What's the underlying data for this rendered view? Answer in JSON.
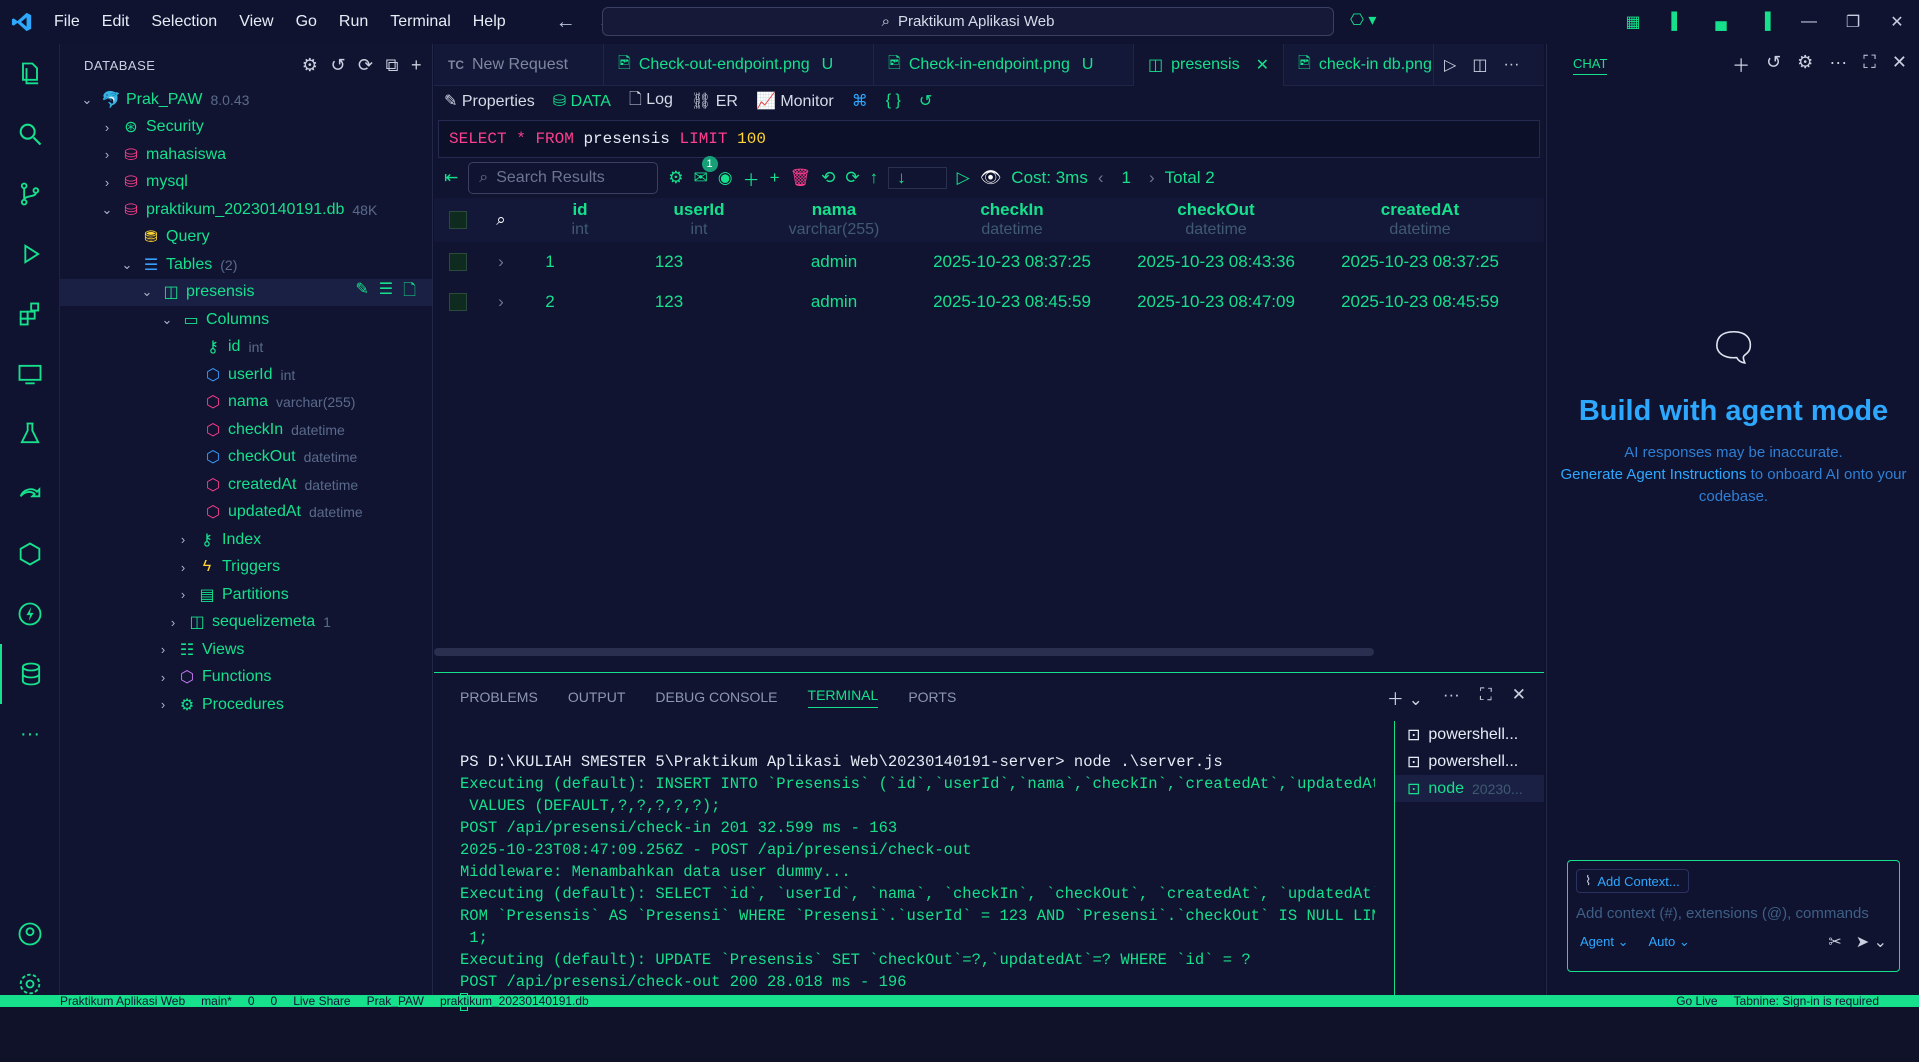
{
  "menu": [
    "File",
    "Edit",
    "Selection",
    "View",
    "Go",
    "Run",
    "Terminal",
    "Help"
  ],
  "command_center": "Praktikum Aplikasi Web",
  "sidebar": {
    "title": "DATABASE",
    "connection": {
      "name": "Prak_PAW",
      "version": "8.0.43"
    },
    "items": [
      {
        "label": "Security"
      },
      {
        "label": "mahasiswa"
      },
      {
        "label": "mysql"
      },
      {
        "label": "praktikum_20230140191.db",
        "sub": "48K"
      },
      {
        "label": "Query"
      },
      {
        "label": "Tables",
        "sub": "(2)"
      },
      {
        "label": "presensis"
      },
      {
        "label": "Columns"
      },
      {
        "label": "id",
        "sub": "int"
      },
      {
        "label": "userId",
        "sub": "int"
      },
      {
        "label": "nama",
        "sub": "varchar(255)"
      },
      {
        "label": "checkIn",
        "sub": "datetime"
      },
      {
        "label": "checkOut",
        "sub": "datetime"
      },
      {
        "label": "createdAt",
        "sub": "datetime"
      },
      {
        "label": "updatedAt",
        "sub": "datetime"
      },
      {
        "label": "Index"
      },
      {
        "label": "Triggers"
      },
      {
        "label": "Partitions"
      },
      {
        "label": "sequelizemeta",
        "sub": "1"
      },
      {
        "label": "Views"
      },
      {
        "label": "Functions"
      },
      {
        "label": "Procedures"
      }
    ]
  },
  "tabs": [
    {
      "label": "New Request",
      "prefix": "TC"
    },
    {
      "label": "Check-out-endpoint.png",
      "badge": "U"
    },
    {
      "label": "Check-in-endpoint.png",
      "badge": "U"
    },
    {
      "label": "presensis"
    },
    {
      "label": "check-in db.png"
    }
  ],
  "subtool": [
    "Properties",
    "DATA",
    "Log",
    "ER",
    "Monitor"
  ],
  "sql": {
    "k1": "SELECT",
    "star": "*",
    "k2": "FROM",
    "table": "presensis",
    "k3": "LIMIT",
    "limit": "100"
  },
  "grid": {
    "search_placeholder": "Search Results",
    "badge": "1",
    "cost": "Cost: 3ms",
    "page": "1",
    "total": "Total 2",
    "columns": [
      {
        "name": "id",
        "type": "int"
      },
      {
        "name": "userId",
        "type": "int"
      },
      {
        "name": "nama",
        "type": "varchar(255)"
      },
      {
        "name": "checkIn",
        "type": "datetime"
      },
      {
        "name": "checkOut",
        "type": "datetime"
      },
      {
        "name": "createdAt",
        "type": "datetime"
      }
    ],
    "rows": [
      [
        "1",
        "123",
        "admin",
        "2025-10-23 08:37:25",
        "2025-10-23 08:43:36",
        "2025-10-23 08:37:25"
      ],
      [
        "2",
        "123",
        "admin",
        "2025-10-23 08:45:59",
        "2025-10-23 08:47:09",
        "2025-10-23 08:45:59"
      ]
    ]
  },
  "panel": {
    "tabs": [
      "PROBLEMS",
      "OUTPUT",
      "DEBUG CONSOLE",
      "TERMINAL",
      "PORTS"
    ],
    "terminal_lines": [
      "PS D:\\KULIAH SMESTER 5\\Praktikum Aplikasi Web\\20230140191-server> node .\\server.js",
      "Executing (default): INSERT INTO `Presensis` (`id`,`userId`,`nama`,`checkIn`,`createdAt`,`updatedAt`)",
      " VALUES (DEFAULT,?,?,?,?,?);",
      "POST /api/presensi/check-in 201 32.599 ms - 163",
      "2025-10-23T08:47:09.256Z - POST /api/presensi/check-out",
      "Middleware: Menambahkan data user dummy...",
      "Executing (default): SELECT `id`, `userId`, `nama`, `checkIn`, `checkOut`, `createdAt`, `updatedAt` F",
      "ROM `Presensis` AS `Presensi` WHERE `Presensi`.`userId` = 123 AND `Presensi`.`checkOut` IS NULL LIMIT",
      " 1;",
      "Executing (default): UPDATE `Presensis` SET `checkOut`=?,`updatedAt`=? WHERE `id` = ?",
      "POST /api/presensi/check-out 200 28.018 ms - 196"
    ],
    "terminals": [
      {
        "label": "powershell..."
      },
      {
        "label": "powershell..."
      },
      {
        "label": "node",
        "sub": "20230..."
      }
    ]
  },
  "chat": {
    "title": "CHAT",
    "heading": "Build with agent mode",
    "note": "AI responses may be inaccurate.",
    "link": "Generate Agent Instructions",
    "link_rest": " to onboard AI onto your codebase.",
    "add_context": "Add Context...",
    "placeholder": "Add context (#), extensions (@), commands",
    "mode": "Agent",
    "model": "Auto"
  },
  "status": [
    "Praktikum Aplikasi Web",
    "main*",
    "0",
    "0",
    "Live Share",
    "Prak_PAW",
    "praktikum_20230140191.db",
    "Go Live",
    "Tabnine: Sign-in is required"
  ],
  "colors": {
    "accent": "#16e08c",
    "bg": "#101430",
    "pink": "#ff3e8f",
    "blue": "#2ea8ff"
  }
}
